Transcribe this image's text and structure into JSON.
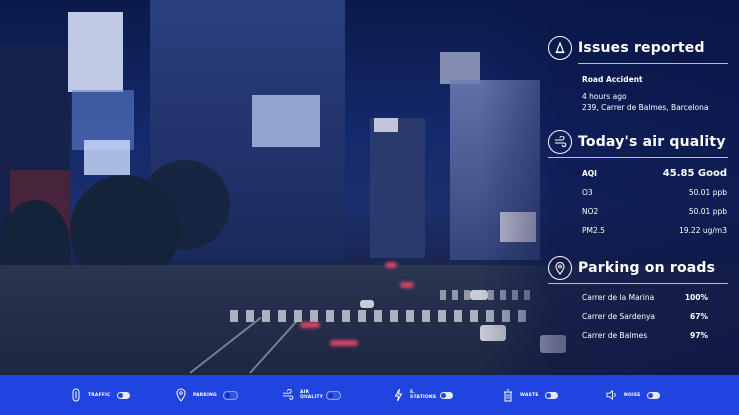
{
  "issues": {
    "title": "Issues reported",
    "item_title": "Road Accident",
    "item_time": "4 hours ago",
    "item_address": "239, Carrer de Balmes, Barcelona"
  },
  "air": {
    "title": "Today's air quality",
    "rows": [
      {
        "label": "AQI",
        "value": "45.85 Good"
      },
      {
        "label": "O3",
        "value": "50.01 ppb"
      },
      {
        "label": "NO2",
        "value": "50.01 ppb"
      },
      {
        "label": "PM2.5",
        "value": "19.22 ug/m3"
      }
    ]
  },
  "parking": {
    "title": "Parking on roads",
    "rows": [
      {
        "label": "Carrer de la Marina",
        "value": "100%"
      },
      {
        "label": "Carrer de Sardenya",
        "value": "67%"
      },
      {
        "label": "Carrer de Balmes",
        "value": "97%"
      }
    ]
  },
  "toolbar": {
    "items": [
      {
        "label": "TRAFFIC",
        "icon": "traffic-icon",
        "on": true
      },
      {
        "label": "PARKING",
        "icon": "parking-icon",
        "on": false
      },
      {
        "label": "AIR QUALITY",
        "icon": "wind-icon",
        "on": false
      },
      {
        "label": "E. STATIONS",
        "icon": "bolt-icon",
        "on": true
      },
      {
        "label": "WASTE",
        "icon": "trash-icon",
        "on": true
      },
      {
        "label": "NOISE",
        "icon": "speaker-icon",
        "on": true
      }
    ]
  },
  "colors": {
    "toolbar_bg": "#1f44e0",
    "panel_text": "#ffffff"
  }
}
